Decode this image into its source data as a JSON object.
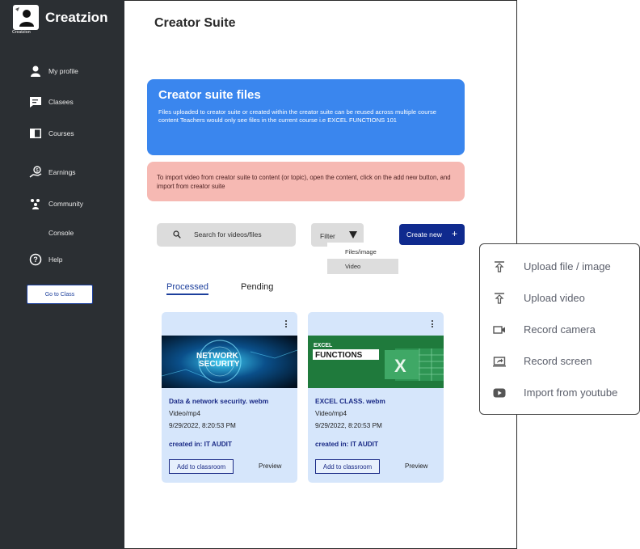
{
  "brand": {
    "name": "Creatzion",
    "logo_caption": "Creatzion"
  },
  "sidebar": {
    "items": [
      {
        "label": "My profile",
        "icon": "user-icon"
      },
      {
        "label": "Clasees",
        "icon": "chat-icon"
      },
      {
        "label": "Courses",
        "icon": "book-icon"
      },
      {
        "label": "Earnings",
        "icon": "money-hand-icon"
      },
      {
        "label": "Community",
        "icon": "community-icon"
      },
      {
        "label": "Console",
        "icon": ""
      },
      {
        "label": "Help",
        "icon": "help-circle-icon"
      }
    ],
    "goto_class": "Go to Class"
  },
  "page": {
    "title": "Creator Suite"
  },
  "info_blue": {
    "title": "Creator suite files",
    "body": "Files uploaded to creator suite or created within the creator suite can be reused across multiple course content Teachers would only see files in the current course i.e EXCEL FUNCTIONS 101"
  },
  "info_pink": {
    "body": "To import video from creator suite to content (or topic), open the content, click on the add new button, and import from creator suite"
  },
  "toolbar": {
    "search_label": "Search for videos/files",
    "filter_label": "Filter",
    "filter_options": [
      "Files/image",
      "Video"
    ],
    "filter_selected": "Video",
    "create_label": "Create new",
    "create_plus": "+"
  },
  "tabs": [
    {
      "label": "Processed",
      "active": true
    },
    {
      "label": "Pending",
      "active": false
    }
  ],
  "cards": [
    {
      "title": "Data & network security. webm",
      "type": "Video/mp4",
      "date": "9/29/2022, 8:20:53 PM",
      "created": "created in: IT AUDIT",
      "add_label": "Add to classroom",
      "preview_label": "Preview",
      "thumb_text": [
        "NETWORK",
        "SECURITY"
      ]
    },
    {
      "title": "EXCEL CLASS. webm",
      "type": "Video/mp4",
      "date": "9/29/2022, 8:20:53 PM",
      "created": "created in: IT AUDIT",
      "add_label": "Add to classroom",
      "preview_label": "Preview",
      "thumb_text": [
        "EXCEL",
        "FUNCTIONS",
        "X"
      ]
    }
  ],
  "upload_menu": [
    {
      "label": "Upload file / image",
      "icon": "upload-icon"
    },
    {
      "label": "Upload video",
      "icon": "upload-icon"
    },
    {
      "label": "Record camera",
      "icon": "camera-icon"
    },
    {
      "label": "Record screen",
      "icon": "screen-share-icon"
    },
    {
      "label": "Import from youtube",
      "icon": "youtube-icon"
    }
  ],
  "colors": {
    "sidebar": "#2b2f33",
    "accent_blue": "#3a86ee",
    "alert_pink": "#f6b9b3",
    "primary_navy": "#0f2a8e",
    "card_bg": "#d6e6fb",
    "excel_green": "#1f7a3c"
  }
}
